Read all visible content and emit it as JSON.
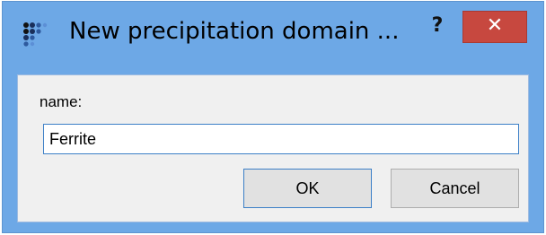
{
  "window": {
    "title": "New precipitation domain ...",
    "help_label": "?",
    "close_label": "✕",
    "accent": "#6da8e6",
    "close_color": "#c7483f"
  },
  "form": {
    "name_label": "name:",
    "name_value": "Ferrite"
  },
  "buttons": {
    "ok_label": "OK",
    "cancel_label": "Cancel"
  }
}
